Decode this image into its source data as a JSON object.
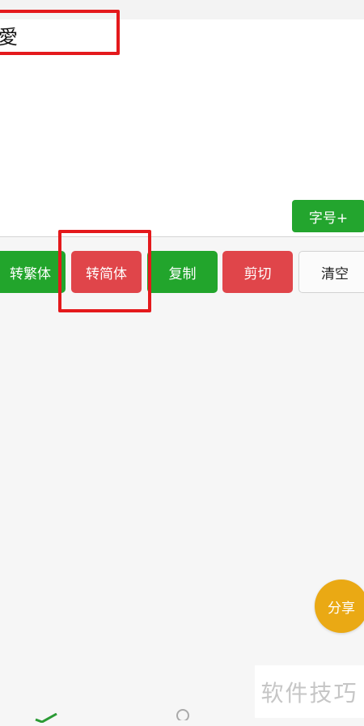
{
  "editor": {
    "text": "愛"
  },
  "buttons": {
    "font_size_plus": "字号+",
    "to_traditional": "转繁体",
    "to_simplified": "转简体",
    "copy": "复制",
    "cut": "剪切",
    "clear": "清空",
    "share": "分享"
  },
  "watermark": "软件技巧",
  "colors": {
    "green": "#22a52c",
    "red": "#e0454a",
    "share": "#eaa914",
    "highlight": "#e4191c"
  },
  "bottom_nav": {
    "icons": [
      "check-icon",
      "person-icon"
    ]
  }
}
